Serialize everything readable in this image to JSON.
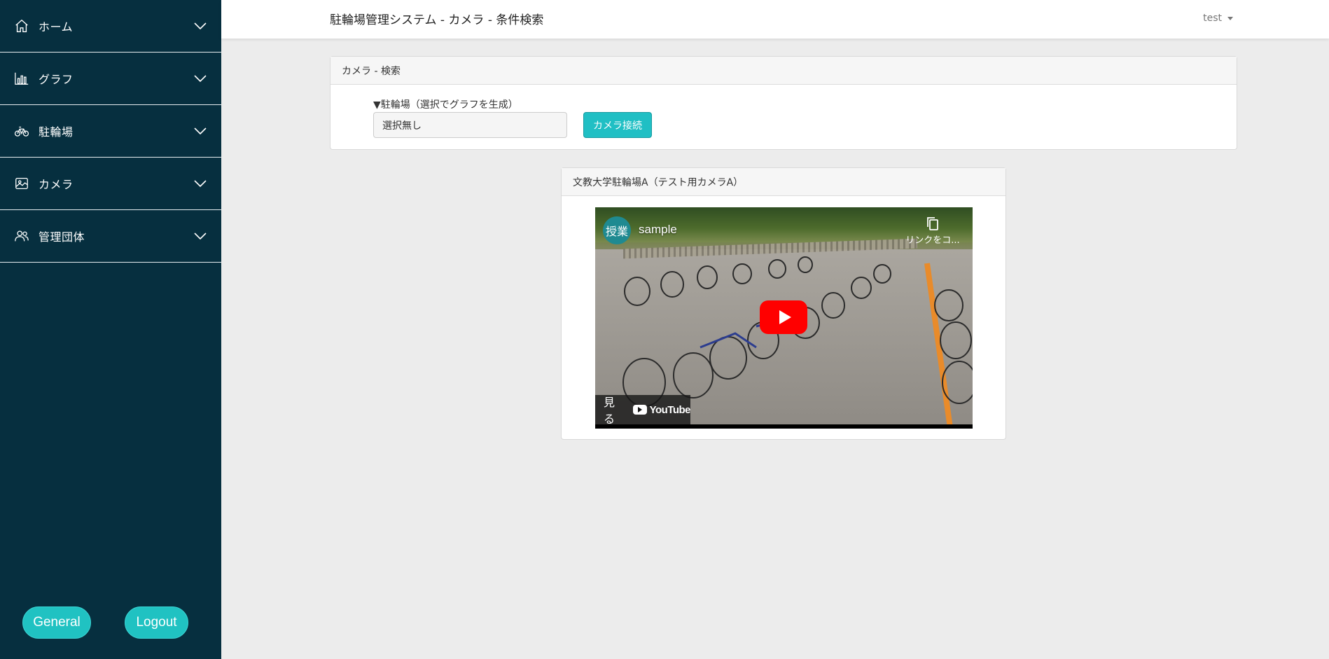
{
  "sidebar": {
    "items": [
      {
        "label": "ホーム",
        "icon": "home-icon"
      },
      {
        "label": "グラフ",
        "icon": "bar-chart-icon"
      },
      {
        "label": "駐輪場",
        "icon": "bicycle-icon"
      },
      {
        "label": "カメラ",
        "icon": "image-icon"
      },
      {
        "label": "管理団体",
        "icon": "users-icon"
      }
    ],
    "general_label": "General",
    "logout_label": "Logout",
    "background": "#062f3f",
    "button_color": "#20c2c2"
  },
  "header": {
    "title": "駐輪場管理システム - カメラ - 条件検索",
    "user": "test"
  },
  "search": {
    "card_title": "カメラ - 検索",
    "field_label": "▼駐輪場（選択でグラフを生成）",
    "selected_value": "選択無し",
    "connect_button": "カメラ接続"
  },
  "camera": {
    "card_title": "文教大学駐輪場A（テスト用カメラA）",
    "video": {
      "channel_avatar": "授業",
      "video_title": "sample",
      "copy_link_label": "リンクをコ...",
      "watch_label": "見る",
      "brand": "YouTube"
    }
  }
}
